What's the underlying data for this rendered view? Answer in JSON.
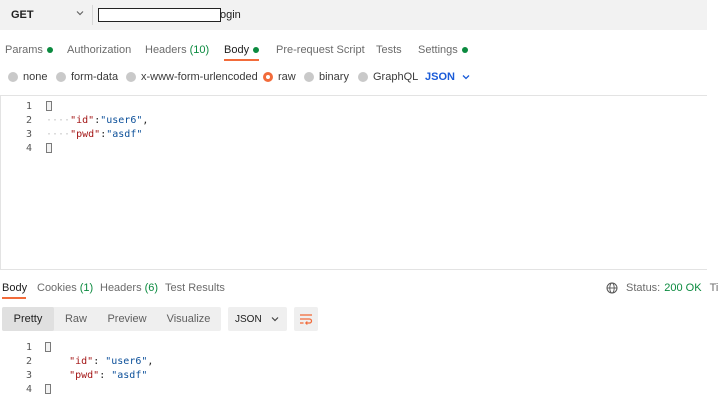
{
  "request": {
    "method": "GET",
    "url_suffix": "ogin"
  },
  "request_tabs": [
    {
      "label": "Params",
      "dot": true
    },
    {
      "label": "Authorization"
    },
    {
      "label": "Headers",
      "count": "(10)"
    },
    {
      "label": "Body",
      "dot": true,
      "active": true
    },
    {
      "label": "Pre-request Script"
    },
    {
      "label": "Tests"
    },
    {
      "label": "Settings",
      "dot": true
    }
  ],
  "body_types": {
    "none": "none",
    "form_data": "form-data",
    "urlencoded": "x-www-form-urlencoded",
    "raw": "raw",
    "binary": "binary",
    "graphql": "GraphQL",
    "selected_format": "JSON"
  },
  "request_body": {
    "line_numbers": [
      "1",
      "2",
      "3",
      "4"
    ],
    "key1": "\"id\"",
    "val1": "\"user6\"",
    "key2": "\"pwd\"",
    "val2": "\"asdf\""
  },
  "response_tabs": [
    {
      "label": "Body",
      "active": true
    },
    {
      "label": "Cookies",
      "count": "(1)"
    },
    {
      "label": "Headers",
      "count": "(6)"
    },
    {
      "label": "Test Results"
    }
  ],
  "response_status": {
    "label": "Status:",
    "value": "200 OK",
    "trailing": "Ti"
  },
  "response_views": [
    "Pretty",
    "Raw",
    "Preview",
    "Visualize"
  ],
  "response_format": "JSON",
  "response_body": {
    "line_numbers": [
      "1",
      "2",
      "3",
      "4"
    ],
    "key1": "\"id\"",
    "val1": "\"user6\"",
    "key2": "\"pwd\"",
    "val2": "\"asdf\""
  },
  "colors": {
    "accent": "#f26b3a",
    "success": "#0b8a3f",
    "link": "#1a5bd8"
  }
}
